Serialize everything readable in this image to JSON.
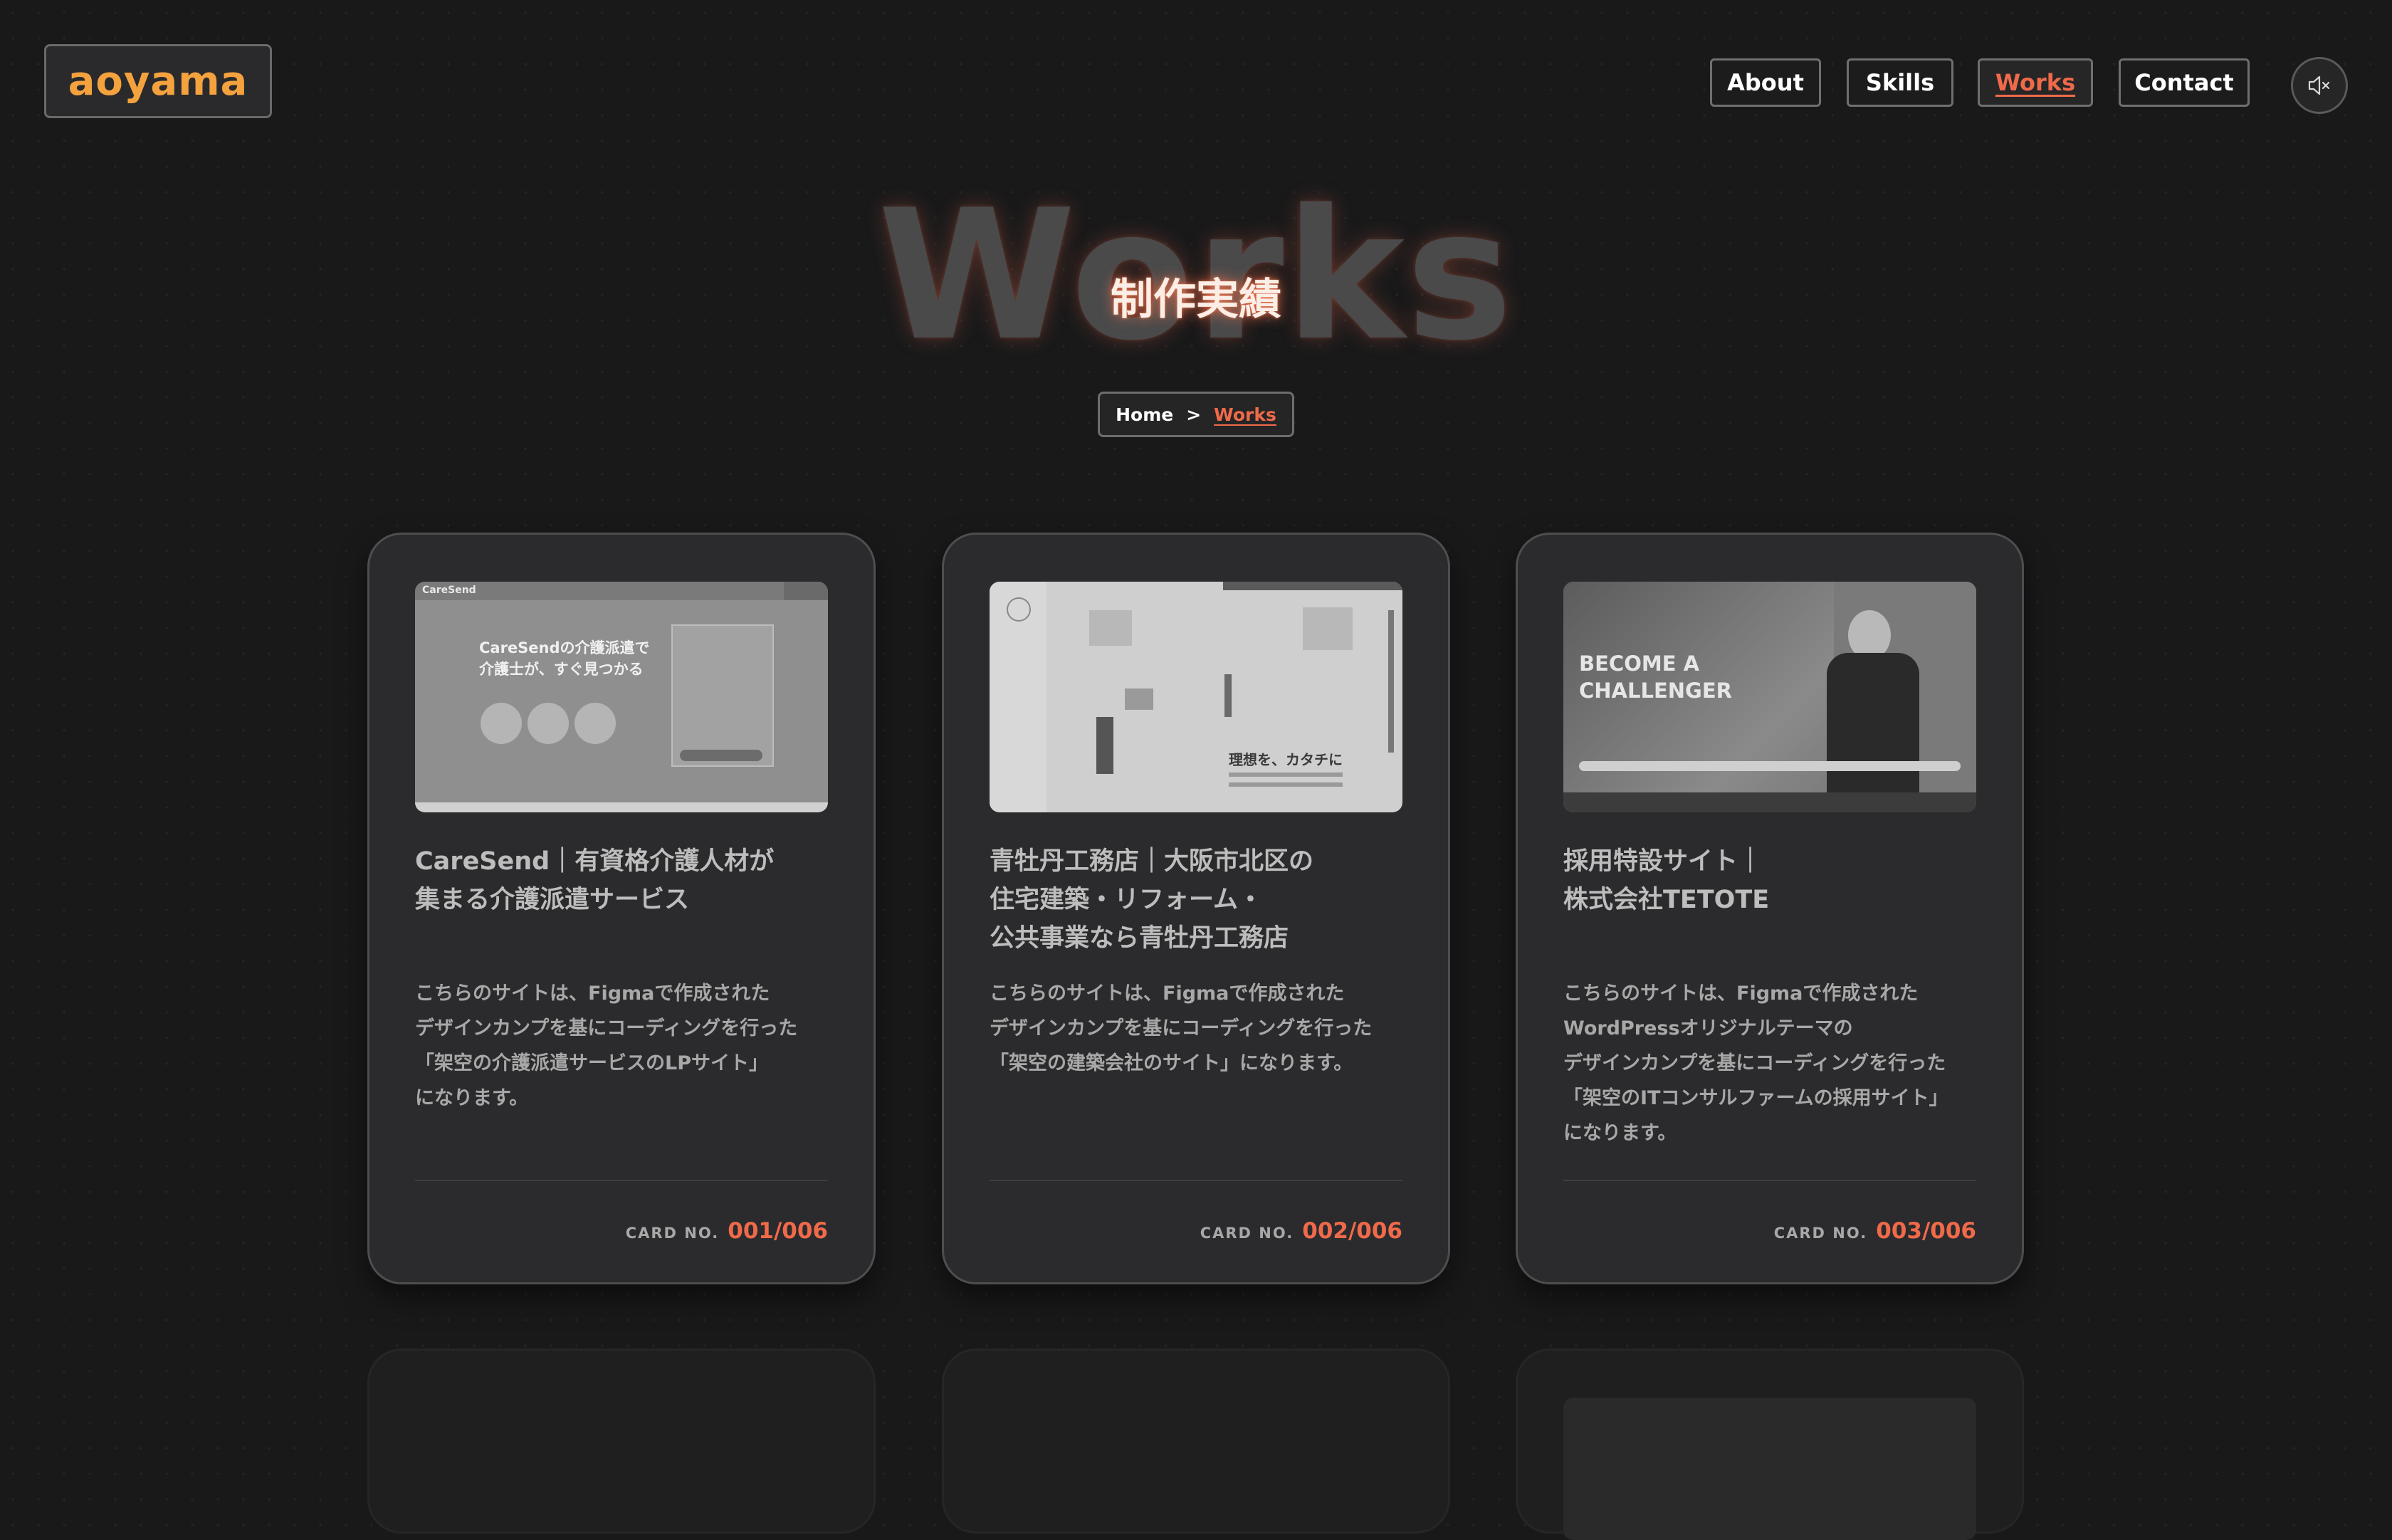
{
  "header": {
    "logo": "aoyama",
    "nav": [
      {
        "label": "About",
        "active": false
      },
      {
        "label": "Skills",
        "active": false
      },
      {
        "label": "Works",
        "active": true
      },
      {
        "label": "Contact",
        "active": false
      }
    ],
    "sound_icon": "speaker-muted-icon"
  },
  "hero": {
    "bg_word": "Works",
    "title": "制作実績"
  },
  "breadcrumb": {
    "home": "Home",
    "separator": ">",
    "current": "Works"
  },
  "colors": {
    "accent": "#f06a4a",
    "logo": "#f4a23e",
    "background": "#19191a",
    "card": "#2b2b2d"
  },
  "cards": [
    {
      "title": "CareSend｜有資格介護人材が\n集まる介護派遣サービス",
      "description": "こちらのサイトは、Figmaで作成された\nデザインカンプを基にコーディングを行った\n「架空の介護派遣サービスのLPサイト」\nになります。",
      "card_no_label": "CARD NO.",
      "card_no": "001/006",
      "thumb": {
        "brand": "CareSend",
        "headline": "CareSendの介護派遣で\n介護士が、すぐ見つかる"
      }
    },
    {
      "title": "青牡丹工務店｜大阪市北区の\n住宅建築・リフォーム・\n公共事業なら青牡丹工務店",
      "description": "こちらのサイトは、Figmaで作成された\nデザインカンプを基にコーディングを行った\n「架空の建築会社のサイト」になります。",
      "card_no_label": "CARD NO.",
      "card_no": "002/006",
      "thumb": {
        "headline": "理想を、カタチに"
      }
    },
    {
      "title": "採用特設サイト｜\n株式会社TETOTE",
      "description": "こちらのサイトは、Figmaで作成された\nWordPressオリジナルテーマの\nデザインカンプを基にコーディングを行った\n「架空のITコンサルファームの採用サイト」\nになります。",
      "card_no_label": "CARD NO.",
      "card_no": "003/006",
      "thumb": {
        "headline": "BECOME A\nCHALLENGER"
      }
    }
  ]
}
